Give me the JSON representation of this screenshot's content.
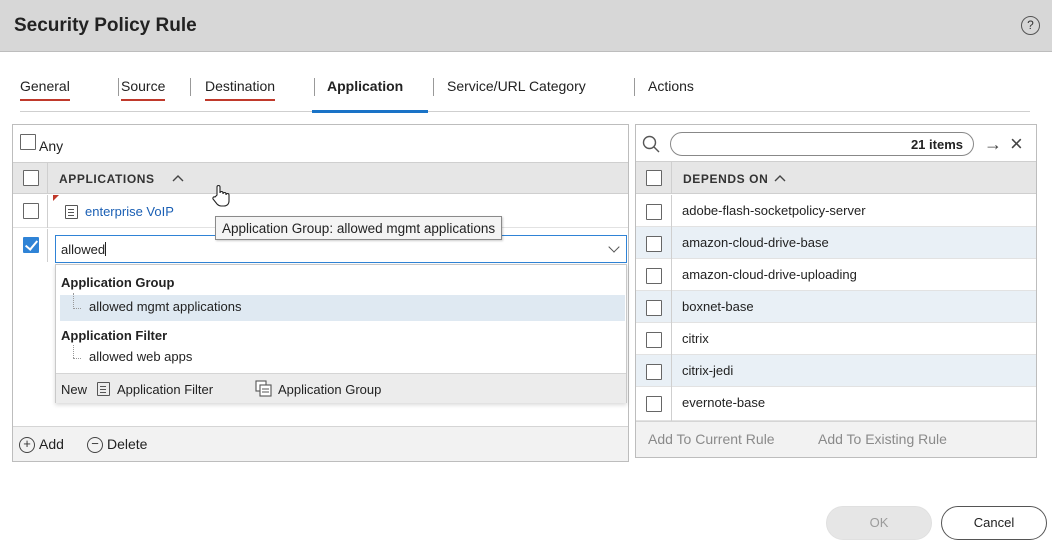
{
  "window": {
    "title": "Security Policy Rule",
    "help_icon": "help-circle-icon",
    "help_glyph": "?"
  },
  "tabs": [
    {
      "label": "General",
      "error": true
    },
    {
      "label": "Source",
      "error": true
    },
    {
      "label": "Destination",
      "error": true
    },
    {
      "label": "Application",
      "active": true
    },
    {
      "label": "Service/URL Category"
    },
    {
      "label": "Actions"
    }
  ],
  "applications": {
    "any_label": "Any",
    "any_checked": false,
    "column_header": "APPLICATIONS",
    "sort_icon": "chevron-up-icon",
    "rows": [
      {
        "name": "enterprise VoIP",
        "checked": false,
        "icon": "application-filter-icon"
      }
    ],
    "editor": {
      "checked": true,
      "value": "allowed"
    },
    "dropdown": {
      "groups": [
        {
          "title": "Application Group",
          "items": [
            "allowed mgmt applications"
          ]
        },
        {
          "title": "Application Filter",
          "items": [
            "allowed web apps"
          ]
        }
      ],
      "new_label": "New",
      "new_filter_label": "Application Filter",
      "new_group_label": "Application Group"
    },
    "tooltip": "Application Group: allowed mgmt applications",
    "add_label": "Add",
    "delete_label": "Delete"
  },
  "depends_on": {
    "search_count": "21 items",
    "column_header": "DEPENDS ON",
    "items": [
      "adobe-flash-socketpolicy-server",
      "amazon-cloud-drive-base",
      "amazon-cloud-drive-uploading",
      "boxnet-base",
      "citrix",
      "citrix-jedi",
      "evernote-base"
    ],
    "add_to_current": "Add To Current Rule",
    "add_to_existing": "Add To Existing Rule"
  },
  "buttons": {
    "ok": "OK",
    "cancel": "Cancel"
  },
  "colors": {
    "accent": "#1a73c7",
    "error_underline": "#c0392b",
    "link": "#1a5fb4",
    "selected_row": "#dfe9f2"
  }
}
